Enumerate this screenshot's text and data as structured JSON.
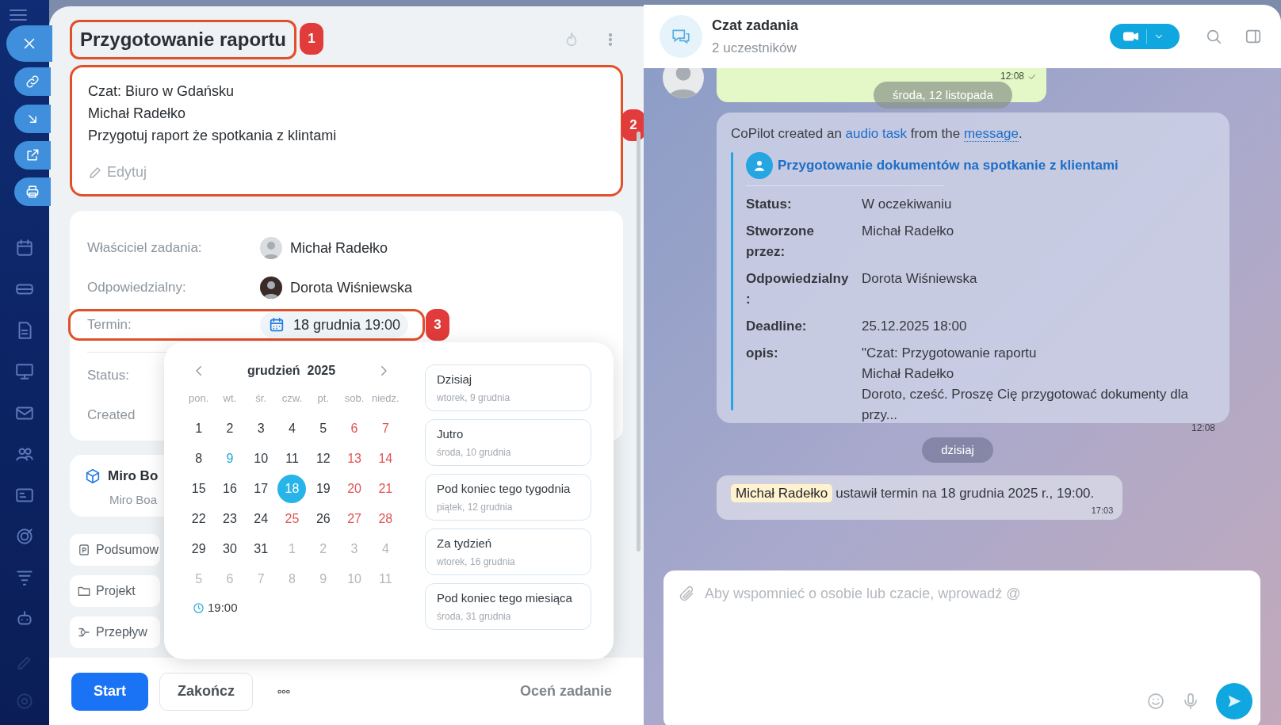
{
  "callouts": [
    "1",
    "2",
    "3"
  ],
  "task": {
    "title": "Przygotowanie raportu",
    "description": [
      "Czat: Biuro w Gdańsku",
      "Michał Radełko",
      "Przygotuj raport że spotkania z klintami"
    ],
    "edit_label": "Edytuj",
    "fields": [
      {
        "label": "Właściciel zadania:",
        "value": "Michał Radełko",
        "kind": "person"
      },
      {
        "label": "Odpowiedzialny:",
        "value": "Dorota Wiśniewska",
        "kind": "person"
      },
      {
        "label": "Termin:",
        "value": "18 grudnia 19:00",
        "kind": "date"
      },
      {
        "label": "Status:",
        "kind": "plain"
      },
      {
        "label": "Created",
        "kind": "plain"
      }
    ],
    "miro": {
      "title": "Miro Bo",
      "subtitle": "Miro Boa"
    },
    "sections": [
      {
        "label": "Podsumow",
        "kind": "summary"
      },
      {
        "label": "Projekt",
        "kind": "folder"
      },
      {
        "label": "Przepływ",
        "kind": "flow"
      }
    ],
    "actions": {
      "start": "Start",
      "finish": "Zakończ",
      "rate": "Oceń zadanie"
    }
  },
  "date_picker": {
    "month": "grudzień",
    "year": "2025",
    "weekdays": [
      "pon.",
      "wt.",
      "śr.",
      "czw.",
      "pt.",
      "sob.",
      "niedz."
    ],
    "weeks": [
      [
        {
          "day": "1",
          "kind": "weekday",
          "selected": false
        },
        {
          "day": "2",
          "kind": "weekday",
          "selected": false
        },
        {
          "day": "3",
          "kind": "weekday",
          "selected": false
        },
        {
          "day": "4",
          "kind": "weekday",
          "selected": false
        },
        {
          "day": "5",
          "kind": "weekday",
          "selected": false
        },
        {
          "day": "6",
          "kind": "weekend",
          "selected": false
        },
        {
          "day": "7",
          "kind": "weekend",
          "selected": false
        }
      ],
      [
        {
          "day": "8",
          "kind": "weekday",
          "selected": false
        },
        {
          "day": "9",
          "kind": "today",
          "selected": false
        },
        {
          "day": "10",
          "kind": "weekday",
          "selected": false
        },
        {
          "day": "11",
          "kind": "weekday",
          "selected": false
        },
        {
          "day": "12",
          "kind": "weekday",
          "selected": false
        },
        {
          "day": "13",
          "kind": "weekend",
          "selected": false
        },
        {
          "day": "14",
          "kind": "weekend",
          "selected": false
        }
      ],
      [
        {
          "day": "15",
          "kind": "weekday",
          "selected": false
        },
        {
          "day": "16",
          "kind": "weekday",
          "selected": false
        },
        {
          "day": "17",
          "kind": "weekday",
          "selected": false
        },
        {
          "day": "18",
          "kind": "weekday",
          "selected": true
        },
        {
          "day": "19",
          "kind": "weekday",
          "selected": false
        },
        {
          "day": "20",
          "kind": "weekend",
          "selected": false
        },
        {
          "day": "21",
          "kind": "weekend",
          "selected": false
        }
      ],
      [
        {
          "day": "22",
          "kind": "weekday",
          "selected": false
        },
        {
          "day": "23",
          "kind": "weekday",
          "selected": false
        },
        {
          "day": "24",
          "kind": "weekday",
          "selected": false
        },
        {
          "day": "25",
          "kind": "weekend",
          "selected": false
        },
        {
          "day": "26",
          "kind": "weekday",
          "selected": false
        },
        {
          "day": "27",
          "kind": "weekend",
          "selected": false
        },
        {
          "day": "28",
          "kind": "weekend",
          "selected": false
        }
      ],
      [
        {
          "day": "29",
          "kind": "weekday",
          "selected": false
        },
        {
          "day": "30",
          "kind": "weekday",
          "selected": false
        },
        {
          "day": "31",
          "kind": "weekday",
          "selected": false
        },
        {
          "day": "1",
          "kind": "other",
          "selected": false
        },
        {
          "day": "2",
          "kind": "other",
          "selected": false
        },
        {
          "day": "3",
          "kind": "other",
          "selected": false
        },
        {
          "day": "4",
          "kind": "other",
          "selected": false
        }
      ],
      [
        {
          "day": "5",
          "kind": "other",
          "selected": false
        },
        {
          "day": "6",
          "kind": "other",
          "selected": false
        },
        {
          "day": "7",
          "kind": "other",
          "selected": false
        },
        {
          "day": "8",
          "kind": "other",
          "selected": false
        },
        {
          "day": "9",
          "kind": "other",
          "selected": false
        },
        {
          "day": "10",
          "kind": "other",
          "selected": false
        },
        {
          "day": "11",
          "kind": "other",
          "selected": false
        }
      ]
    ],
    "time": "19:00",
    "presets": [
      {
        "label": "Dzisiaj",
        "date": "wtorek, 9 grudnia"
      },
      {
        "label": "Jutro",
        "date": "środa, 10 grudnia"
      },
      {
        "label": "Pod koniec tego tygodnia",
        "date": "piątek, 12 grudnia"
      },
      {
        "label": "Za tydzień",
        "date": "wtorek, 16 grudnia"
      },
      {
        "label": "Pod koniec tego miesiąca",
        "date": "środa, 31 grudnia"
      }
    ]
  },
  "chat": {
    "title": "Czat zadania",
    "subtitle": "2 uczestników",
    "first_message": {
      "time": "12:08"
    },
    "date_pills": [
      "środa, 12 listopada",
      "dzisiaj"
    ],
    "task_message": {
      "intro": [
        {
          "text": "CoPilot created an ",
          "kind": "text"
        },
        {
          "text": "audio task",
          "kind": "link"
        },
        {
          "text": " from the ",
          "kind": "text"
        },
        {
          "text": "message",
          "kind": "dotted-link"
        },
        {
          "text": ".",
          "kind": "text"
        }
      ],
      "title": "Przygotowanie dokumentów na spotkanie z klientami",
      "fields": [
        {
          "label": "Status:",
          "lines": [
            "W oczekiwaniu"
          ]
        },
        {
          "label": "Stworzone przez:",
          "lines": [
            "Michał Radełko"
          ]
        },
        {
          "label": "Odpowiedzialny :",
          "lines": [
            "Dorota Wiśniewska"
          ]
        },
        {
          "label": "Deadline:",
          "lines": [
            "25.12.2025 18:00"
          ]
        },
        {
          "label": "opis:",
          "lines": [
            "\"Czat: Przygotowanie raportu",
            "Michał Radełko",
            "Doroto, cześć. Proszę Cię przygotować dokumenty dla przy..."
          ]
        }
      ],
      "time": "12:08"
    },
    "system_message": {
      "mention": "Michał Radełko",
      "text": "ustawił termin na 18 grudnia 2025 r., 19:00.",
      "time": "17:03"
    },
    "input": {
      "placeholder": "Aby wspomnieć o osobie lub czacie, wprowadź @"
    }
  }
}
